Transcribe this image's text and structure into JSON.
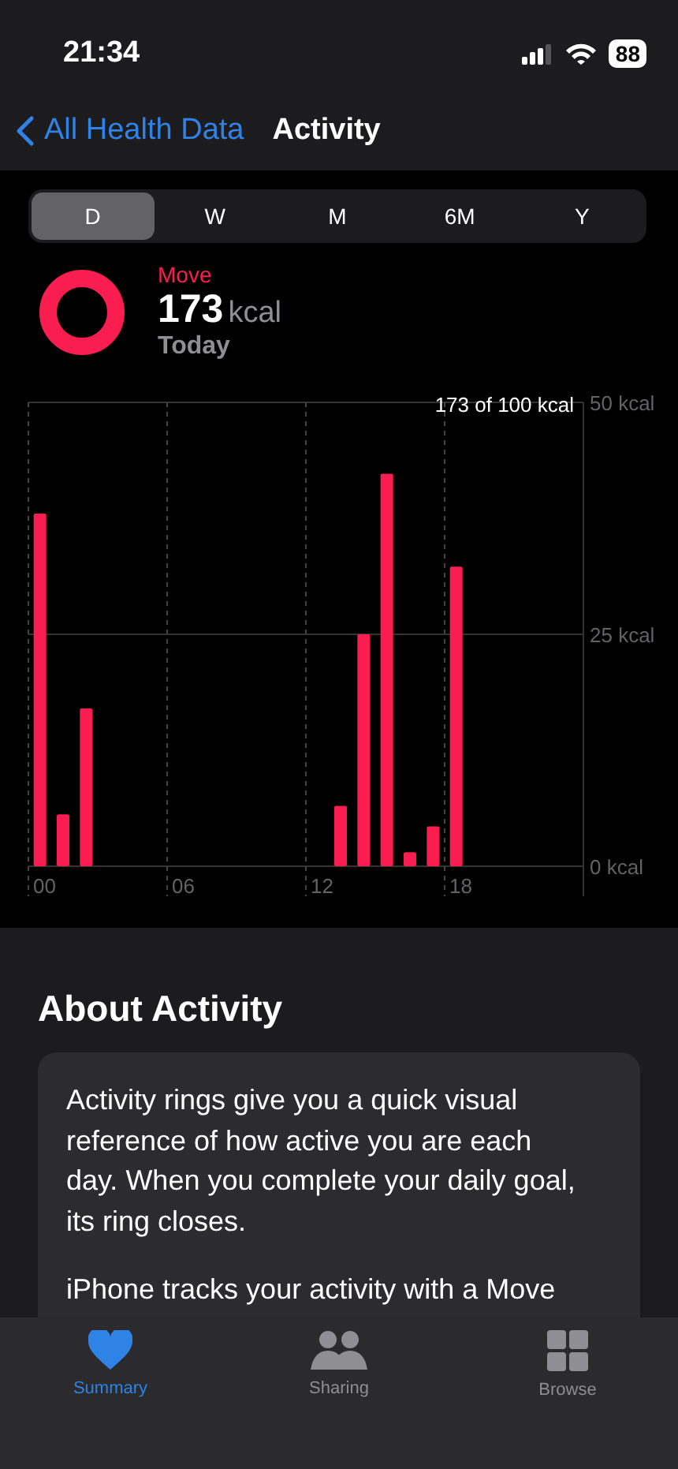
{
  "status_bar": {
    "time": "21:34",
    "battery": "88"
  },
  "nav": {
    "back_label": "All Health Data",
    "title": "Activity"
  },
  "segments": [
    {
      "label": "D",
      "selected": true
    },
    {
      "label": "W",
      "selected": false
    },
    {
      "label": "M",
      "selected": false
    },
    {
      "label": "6M",
      "selected": false
    },
    {
      "label": "Y",
      "selected": false
    }
  ],
  "summary": {
    "metric": "Move",
    "value": "173",
    "unit": "kcal",
    "period": "Today"
  },
  "chart": {
    "goal_label": "173 of 100 kcal",
    "chart_data": {
      "type": "bar",
      "x": [
        0,
        1,
        2,
        13,
        14,
        15,
        16,
        17,
        18
      ],
      "values": [
        38,
        5.6,
        17,
        6.5,
        25,
        42.3,
        1.5,
        4.3,
        32.3
      ],
      "xlim": [
        -0.5,
        23.5
      ],
      "ylim": [
        0,
        50
      ],
      "xticks": [
        {
          "value": 0,
          "label": "00"
        },
        {
          "value": 6,
          "label": "06"
        },
        {
          "value": 12,
          "label": "12"
        },
        {
          "value": 18,
          "label": "18"
        }
      ],
      "yticks": [
        {
          "value": 0,
          "label": "0 kcal"
        },
        {
          "value": 25,
          "label": "25 kcal"
        },
        {
          "value": 50,
          "label": "50 kcal"
        }
      ]
    }
  },
  "about": {
    "heading": "About Activity",
    "paragraphs": [
      "Activity rings give you a quick visual reference of how active you are each day. When you complete your daily goal, its ring closes.",
      "iPhone tracks your activity with a Move"
    ]
  },
  "tab_bar": [
    {
      "label": "Summary",
      "kind": "heart",
      "selected": true
    },
    {
      "label": "Sharing",
      "kind": "people",
      "selected": false
    },
    {
      "label": "Browse",
      "kind": "grid",
      "selected": false
    }
  ]
}
